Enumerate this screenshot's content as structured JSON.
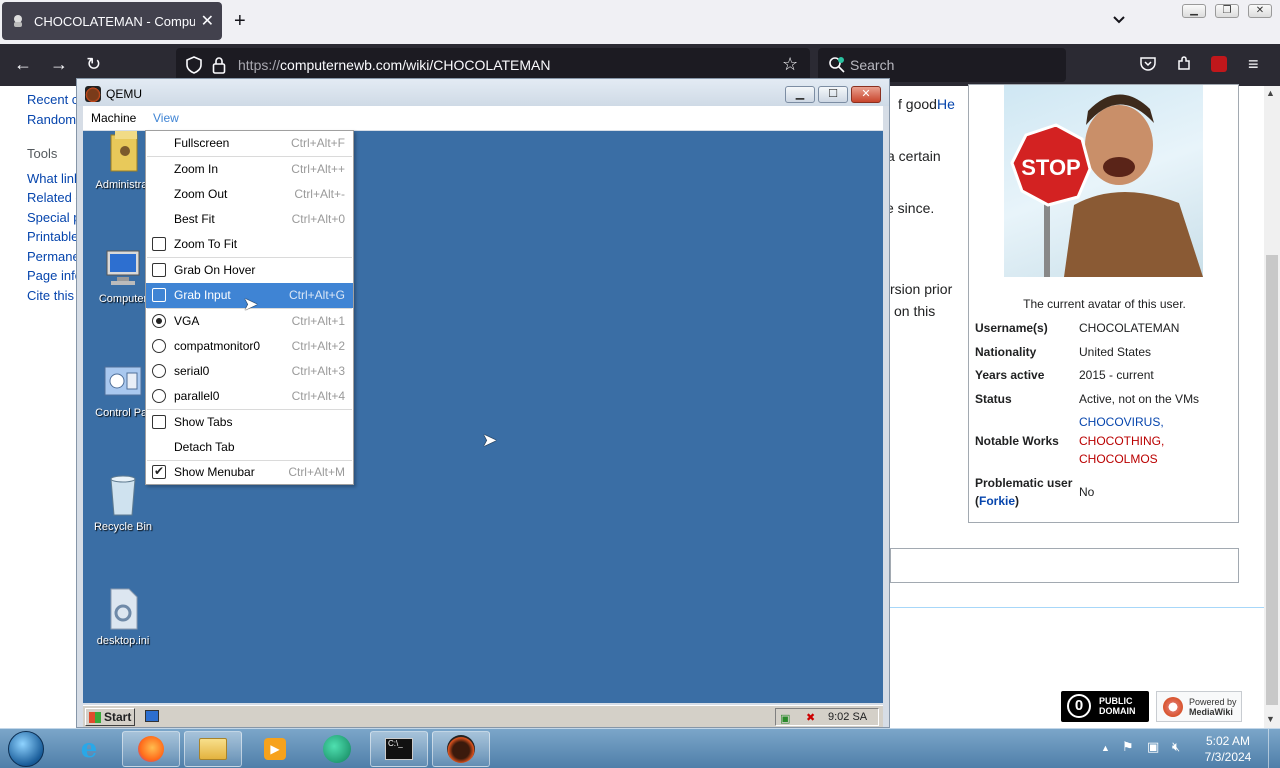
{
  "browser": {
    "tab_title": "CHOCOLATEMAN - Computer",
    "tab_close": "✕",
    "new_tab": "+",
    "url_protocol": "https://",
    "url_rest": "computernewb.com/wiki/CHOCOLATEMAN",
    "search_placeholder": "Search"
  },
  "wiki": {
    "sidebar": {
      "recent": "Recent c",
      "random": "Random",
      "tools_heading": "Tools",
      "tools": [
        "What link",
        "Related c",
        "Special p",
        "Printable",
        "Permane",
        "Page info",
        "Cite this"
      ]
    },
    "fragments": {
      "good": "f good.",
      "he": "He",
      "certain": "a certain",
      "since": "e since.",
      "prior": "rsion prior",
      "onthis": "on this"
    },
    "infobox": {
      "stop": "STOP",
      "caption": "The current avatar of this user.",
      "rows": [
        {
          "k": "Username(s)",
          "v": "CHOCOLATEMAN"
        },
        {
          "k": "Nationality",
          "v": "United States"
        },
        {
          "k": "Years active",
          "v": "2015 - current"
        },
        {
          "k": "Status",
          "v": "Active, not on the VMs"
        }
      ],
      "notable_key": "Notable Works",
      "notable": [
        "CHOCOVIRUS,",
        "CHOCOTHING,",
        "CHOCOLMOS"
      ],
      "problem_key": "Problematic user",
      "problem_link": "Forkie",
      "problem_value": "No"
    },
    "footer": {
      "pd_line1": "PUBLIC",
      "pd_line2": "DOMAIN",
      "mw_line1": "Powered by",
      "mw_line2": "MediaWiki"
    }
  },
  "qemu": {
    "title": "QEMU",
    "menus": [
      "Machine",
      "View"
    ],
    "desktop_icons": [
      "Administrat",
      "Computer",
      "Control Par",
      "Recycle Bin",
      "desktop.ini"
    ],
    "start": "Start",
    "guest_clock": "9:02 SA",
    "view_menu": [
      {
        "label": "Fullscreen",
        "shortcut": "Ctrl+Alt+F",
        "mark": "none",
        "checked": false
      },
      {
        "label": "Zoom In",
        "shortcut": "Ctrl+Alt++",
        "mark": "none",
        "checked": false
      },
      {
        "label": "Zoom Out",
        "shortcut": "Ctrl+Alt+-",
        "mark": "none",
        "checked": false
      },
      {
        "label": "Best Fit",
        "shortcut": "Ctrl+Alt+0",
        "mark": "none",
        "checked": false
      },
      {
        "label": "Zoom To Fit",
        "shortcut": "",
        "mark": "check",
        "checked": false
      },
      {
        "label": "Grab On Hover",
        "shortcut": "",
        "mark": "check",
        "checked": false
      },
      {
        "label": "Grab Input",
        "shortcut": "Ctrl+Alt+G",
        "mark": "check",
        "checked": false,
        "highlight": true
      },
      {
        "label": "VGA",
        "shortcut": "Ctrl+Alt+1",
        "mark": "radio",
        "checked": true
      },
      {
        "label": "compatmonitor0",
        "shortcut": "Ctrl+Alt+2",
        "mark": "radio",
        "checked": false
      },
      {
        "label": "serial0",
        "shortcut": "Ctrl+Alt+3",
        "mark": "radio",
        "checked": false
      },
      {
        "label": "parallel0",
        "shortcut": "Ctrl+Alt+4",
        "mark": "radio",
        "checked": false
      },
      {
        "label": "Show Tabs",
        "shortcut": "",
        "mark": "check",
        "checked": false
      },
      {
        "label": "Detach Tab",
        "shortcut": "",
        "mark": "none",
        "checked": false
      },
      {
        "label": "Show Menubar",
        "shortcut": "Ctrl+Alt+M",
        "mark": "check",
        "checked": true
      }
    ]
  },
  "taskbar": {
    "clock_time": "5:02 AM",
    "clock_date": "7/3/2024"
  },
  "colors": {
    "accent": "#3f84d4",
    "guest_desktop": "#3a6ea5",
    "link": "#0645ad",
    "redlink": "#ba0000"
  }
}
